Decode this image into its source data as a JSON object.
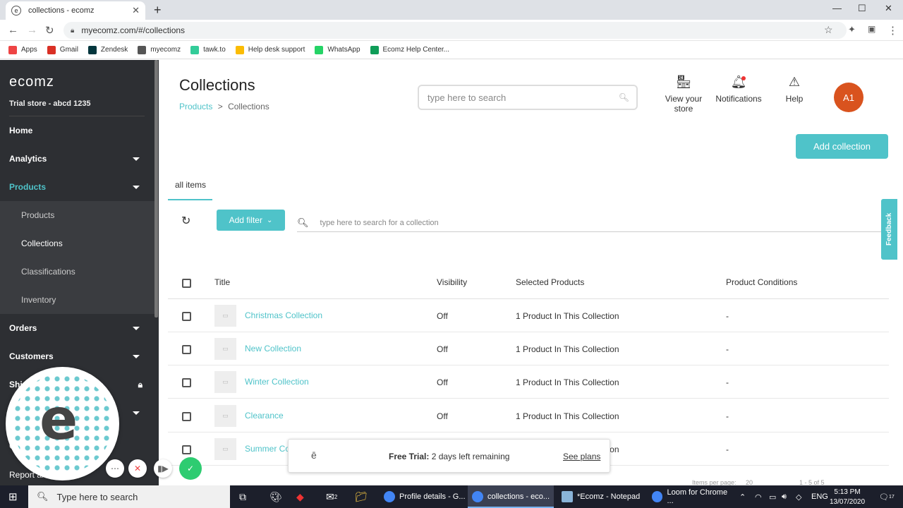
{
  "browser": {
    "tab_title": "collections - ecomz",
    "tab_favicon": "e",
    "url": "myecomz.com/#/collections",
    "bookmarks": [
      {
        "label": "Apps",
        "color": "#e44"
      },
      {
        "label": "Gmail",
        "color": "#d93025"
      },
      {
        "label": "Zendesk",
        "color": "#03363d"
      },
      {
        "label": "myecomz",
        "color": "#555"
      },
      {
        "label": "tawk.to",
        "color": "#3c9"
      },
      {
        "label": "Help desk support",
        "color": "#fbbc04"
      },
      {
        "label": "WhatsApp",
        "color": "#25d366"
      },
      {
        "label": "Ecomz Help Center...",
        "color": "#0f9d58"
      }
    ]
  },
  "sidebar": {
    "logo": "ecomz",
    "store": "Trial store - abcd 1235",
    "items": {
      "home": "Home",
      "analytics": "Analytics",
      "products": "Products",
      "sub_products": "Products",
      "sub_collections": "Collections",
      "sub_classifications": "Classifications",
      "sub_inventory": "Inventory",
      "orders": "Orders",
      "customers": "Customers",
      "shipping_partial": "Shi",
      "c_partial": "C",
      "report_partial": "Report an"
    }
  },
  "header": {
    "title": "Collections",
    "breadcrumb_link": "Products",
    "breadcrumb_sep": ">",
    "breadcrumb_current": "Collections",
    "search_placeholder": "type here to search",
    "view_store": "View your store",
    "notifications": "Notifications",
    "help": "Help",
    "avatar": "A1",
    "add_collection": "Add collection"
  },
  "list": {
    "tab": "all items",
    "add_filter": "Add filter",
    "search_placeholder": "type here to search for a collection",
    "feedback": "Feedback",
    "columns": [
      "Title",
      "Visibility",
      "Selected Products",
      "Product Conditions"
    ],
    "rows": [
      {
        "title": "Christmas Collection",
        "visibility": "Off",
        "products": "1 Product In This Collection",
        "conditions": "-"
      },
      {
        "title": "New Collection",
        "visibility": "Off",
        "products": "1 Product In This Collection",
        "conditions": "-"
      },
      {
        "title": "Winter Collection",
        "visibility": "Off",
        "products": "1 Product In This Collection",
        "conditions": "-"
      },
      {
        "title": "Clearance",
        "visibility": "Off",
        "products": "1 Product In This Collection",
        "conditions": "-"
      },
      {
        "title": "Summer Collection",
        "visibility": "Off",
        "products": "1 Product In This Collection",
        "conditions": "-"
      }
    ],
    "pager_items": "Items per page:",
    "pager_count": "20",
    "pager_range": "1 - 5 of 5"
  },
  "trial": {
    "label": "Free Trial:",
    "remaining": "2 days left remaining",
    "see_plans": "See plans"
  },
  "taskbar": {
    "search": "Type here to search",
    "mail_badge": "2",
    "apps": [
      "Profile details - G...",
      "collections - eco...",
      "*Ecomz - Notepad",
      "Loom for Chrome ..."
    ],
    "lang": "ENG",
    "time": "5:13 PM",
    "date": "13/07/2020",
    "notif_count": "17"
  },
  "colors": {
    "accent": "#4fc3c9",
    "avatar": "#d9531e",
    "sidebar": "#2d2f33"
  }
}
